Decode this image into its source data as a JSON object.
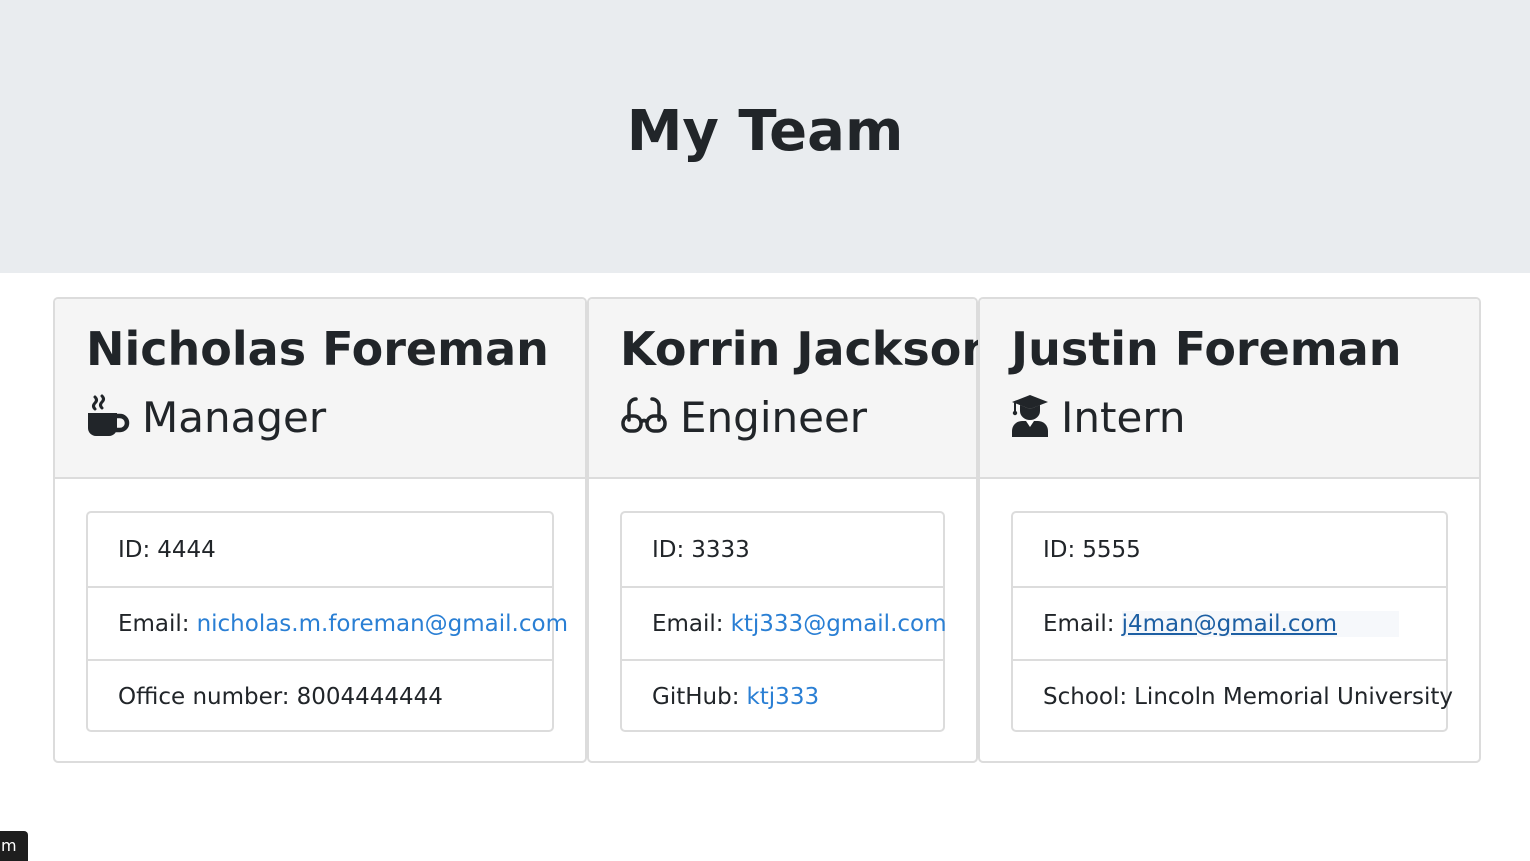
{
  "header": {
    "title": "My Team"
  },
  "cards": [
    {
      "name": "Nicholas Foreman",
      "role": "Manager",
      "icon": "coffee-mug-icon",
      "rows": [
        {
          "label": "ID:",
          "value": "4444"
        },
        {
          "label": "Email:",
          "value": "nicholas.m.foreman@gmail.com"
        },
        {
          "label": "Office number:",
          "value": "8004444444"
        }
      ]
    },
    {
      "name": "Korrin Jackson",
      "role": "Engineer",
      "icon": "glasses-icon",
      "rows": [
        {
          "label": "ID:",
          "value": "3333"
        },
        {
          "label": "Email:",
          "value": "ktj333@gmail.com"
        },
        {
          "label": "GitHub:",
          "value": "ktj333"
        }
      ]
    },
    {
      "name": "Justin Foreman",
      "role": "Intern",
      "icon": "graduate-icon",
      "rows": [
        {
          "label": "ID:",
          "value": "5555"
        },
        {
          "label": "Email:",
          "value": "j4man@gmail.com"
        },
        {
          "label": "School:",
          "value": "Lincoln Memorial University"
        }
      ]
    }
  ],
  "corner_chip": {
    "text": "m"
  },
  "colors": {
    "link": "#2a7fd4",
    "jumbotron": "#e9ecef",
    "header_bg": "#f5f5f5"
  }
}
